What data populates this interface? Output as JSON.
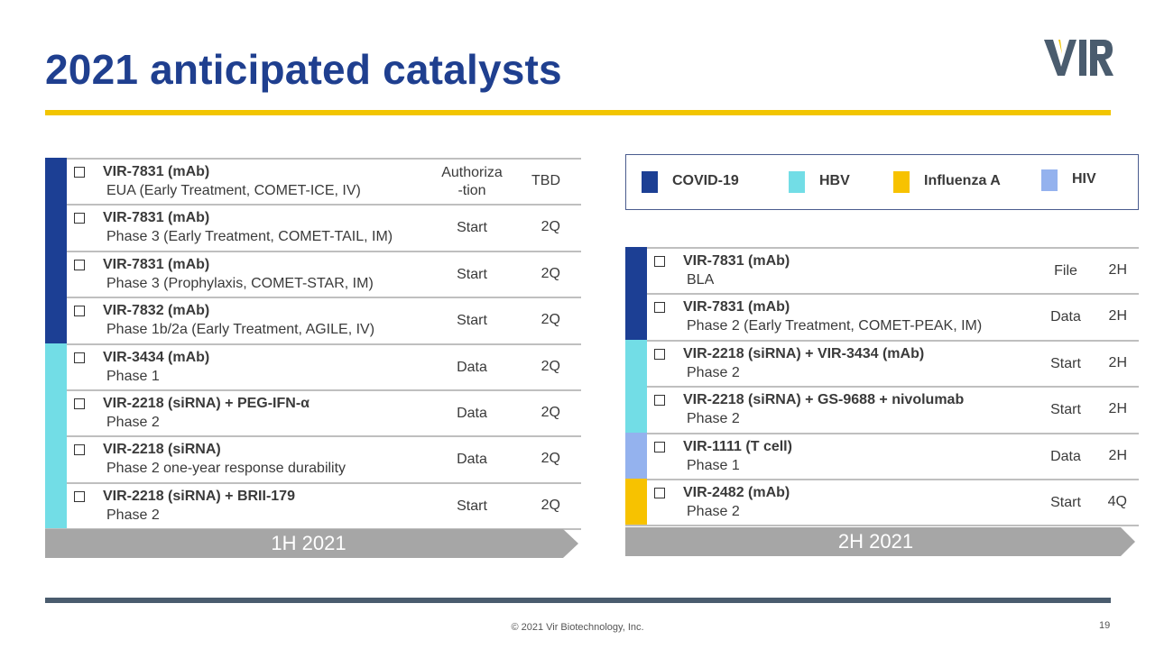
{
  "header": {
    "title": "2021 anticipated catalysts",
    "logo_text": "VIR"
  },
  "colors": {
    "covid": "#1c3f94",
    "hbv": "#72dde6",
    "flu": "#f7c200",
    "hiv": "#94b2ee",
    "arrow": "#a6a6a6",
    "title": "#1f3f8f",
    "gold": "#f2c500"
  },
  "legend": {
    "items": [
      {
        "label": "COVID-19",
        "color": "#1c3f94"
      },
      {
        "label": "HBV",
        "color": "#72dde6"
      },
      {
        "label": "Influenza A",
        "color": "#f7c200"
      },
      {
        "label": "HIV",
        "color": "#94b2ee"
      }
    ]
  },
  "h1": {
    "timeline_label": "1H 2021",
    "rows": [
      {
        "name": "VIR-7831 (mAb)",
        "detail": "EUA (Early Treatment, COMET-ICE, IV)",
        "activity_1": "Authoriza",
        "activity_2": "-tion",
        "timing": "TBD",
        "area": "COVID-19"
      },
      {
        "name": "VIR-7831 (mAb)",
        "detail": "Phase 3 (Early Treatment, COMET-TAIL, IM)",
        "activity_1": "Start",
        "timing": "2Q",
        "area": "COVID-19"
      },
      {
        "name": "VIR-7831 (mAb)",
        "detail": "Phase 3 (Prophylaxis, COMET-STAR, IM)",
        "activity_1": "Start",
        "timing": "2Q",
        "area": "COVID-19"
      },
      {
        "name": "VIR-7832 (mAb)",
        "detail": "Phase 1b/2a (Early Treatment, AGILE, IV)",
        "activity_1": "Start",
        "timing": "2Q",
        "area": "COVID-19"
      },
      {
        "name": "VIR-3434 (mAb)",
        "detail": "Phase 1",
        "activity_1": "Data",
        "timing": "2Q",
        "area": "HBV"
      },
      {
        "name": "VIR-2218 (siRNA) + PEG-IFN-α",
        "detail": "Phase 2",
        "activity_1": "Data",
        "timing": "2Q",
        "area": "HBV"
      },
      {
        "name": "VIR-2218 (siRNA)",
        "detail": "Phase 2 one-year response durability",
        "activity_1": "Data",
        "timing": "2Q",
        "area": "HBV"
      },
      {
        "name": "VIR-2218 (siRNA) + BRII-179",
        "detail": "Phase 2",
        "activity_1": "Start",
        "timing": "2Q",
        "area": "HBV"
      }
    ]
  },
  "h2": {
    "timeline_label": "2H 2021",
    "rows": [
      {
        "name": "VIR-7831 (mAb)",
        "detail": "BLA",
        "activity_1": "File",
        "timing": "2H",
        "area": "COVID-19"
      },
      {
        "name": "VIR-7831 (mAb)",
        "detail": "Phase 2 (Early Treatment, COMET-PEAK, IM)",
        "activity_1": "Data",
        "timing": "2H",
        "area": "COVID-19"
      },
      {
        "name": "VIR-2218 (siRNA) + VIR-3434 (mAb)",
        "detail": "Phase 2",
        "activity_1": "Start",
        "timing": "2H",
        "area": "HBV"
      },
      {
        "name": "VIR-2218 (siRNA) + GS-9688 + nivolumab",
        "detail": "Phase 2",
        "activity_1": "Start",
        "timing": "2H",
        "area": "HBV"
      },
      {
        "name": "VIR-1111 (T cell)",
        "detail": "Phase 1",
        "activity_1": "Data",
        "timing": "2H",
        "area": "HIV"
      },
      {
        "name": "VIR-2482 (mAb)",
        "detail": "Phase 2",
        "activity_1": "Start",
        "timing": "4Q",
        "area": "Influenza A"
      }
    ]
  },
  "footer": {
    "copyright": "© 2021 Vir Biotechnology, Inc.",
    "page": "19"
  }
}
